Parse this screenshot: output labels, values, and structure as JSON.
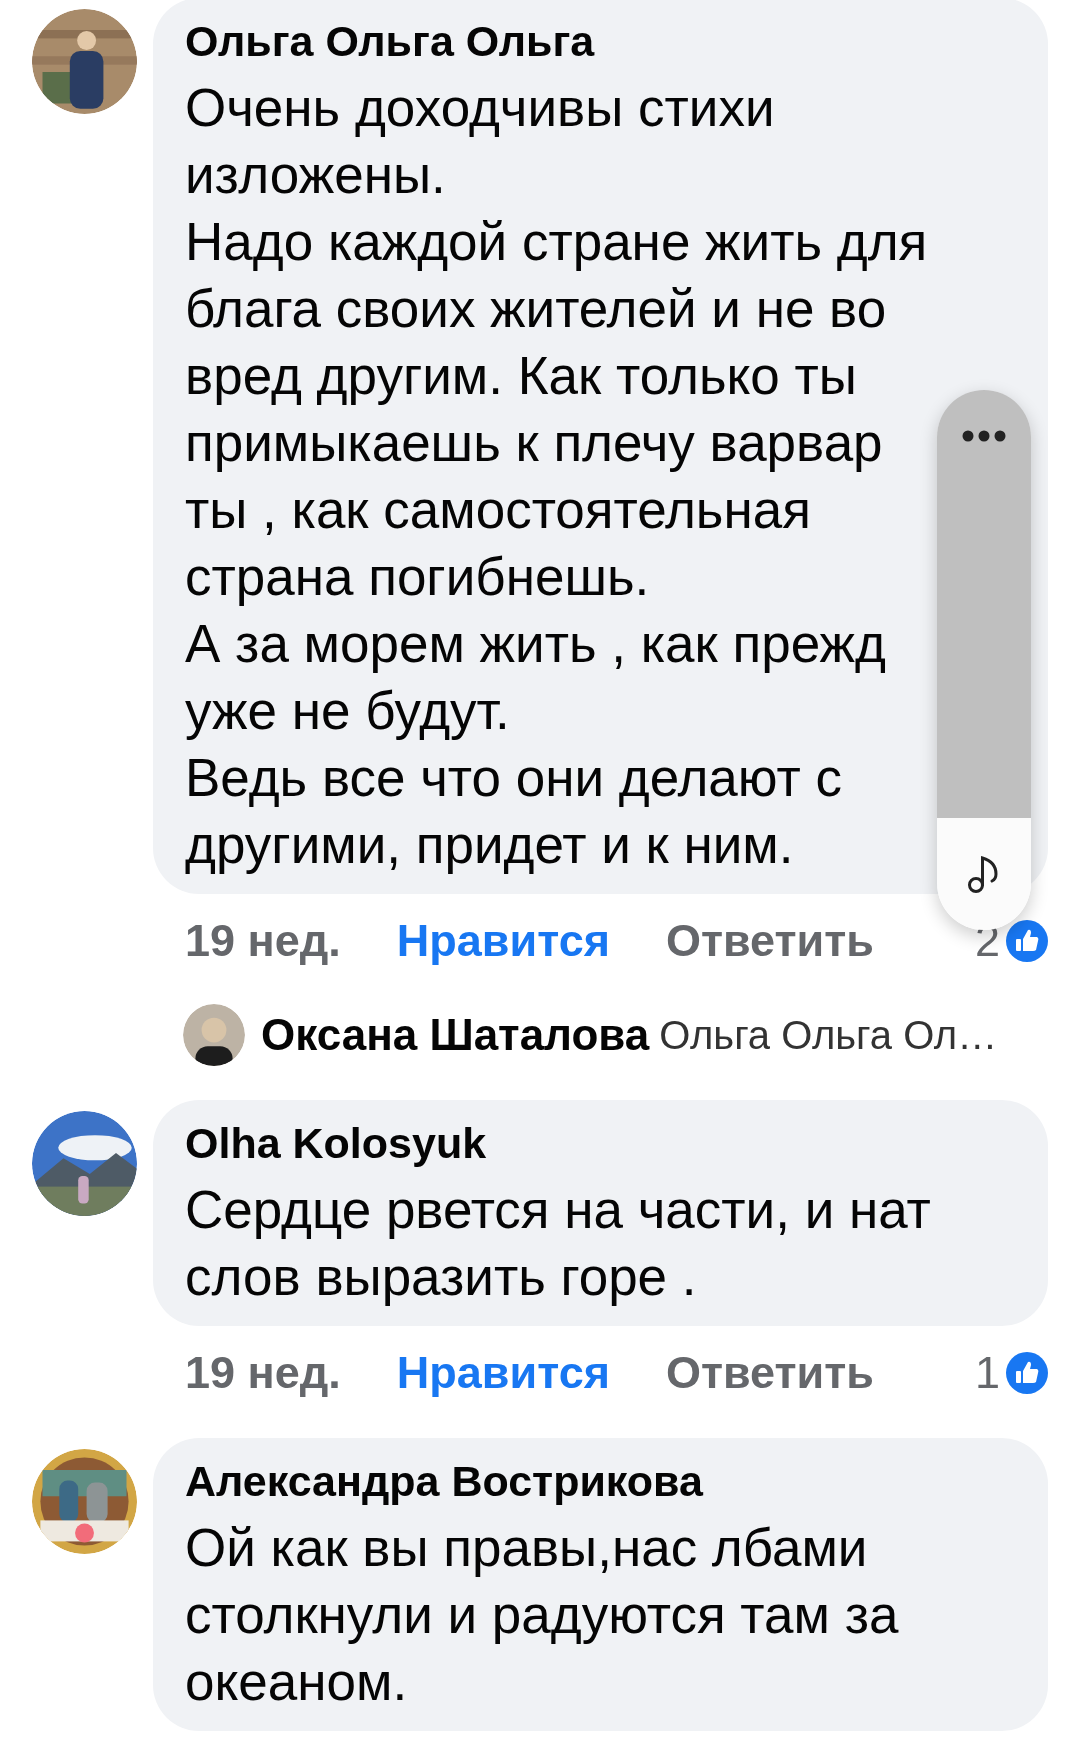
{
  "comments": [
    {
      "author": "Ольга Ольга Ольга",
      "avatar": {
        "kind": "picture"
      },
      "lines": [
        "Очень доходчивы стихи",
        "изложены.",
        "Надо каждой стране жить для",
        "блага своих жителей и не во",
        "вред другим. Как только ты",
        "примыкаешь к плечу варвар",
        "ты , как самостоятельная",
        "страна погибнешь.",
        "А за морем жить , как прежд",
        "уже не будут.",
        "Ведь все что они делают с",
        "другими, придет и к ним."
      ],
      "meta": {
        "time": "19 нед.",
        "like_label": "Нравится",
        "liked": true,
        "reply_label": "Ответить",
        "like_count": "2"
      },
      "reply_preview": {
        "author": "Оксана Шаталова",
        "text": "Ольга Ольга Ол…"
      }
    },
    {
      "author": "Olha Kolosyuk",
      "avatar": {
        "kind": "picture"
      },
      "lines": [
        "Сердце рвется на части, и нат",
        "слов выразить горе ."
      ],
      "meta": {
        "time": "19 нед.",
        "like_label": "Нравится",
        "liked": true,
        "reply_label": "Ответить",
        "like_count": "1"
      }
    },
    {
      "author": "Александра Вострикова",
      "avatar": {
        "kind": "picture"
      },
      "lines": [
        "Ой как вы правы,нас лбами",
        "столкнули и радуются там за",
        "океаном."
      ]
    }
  ]
}
